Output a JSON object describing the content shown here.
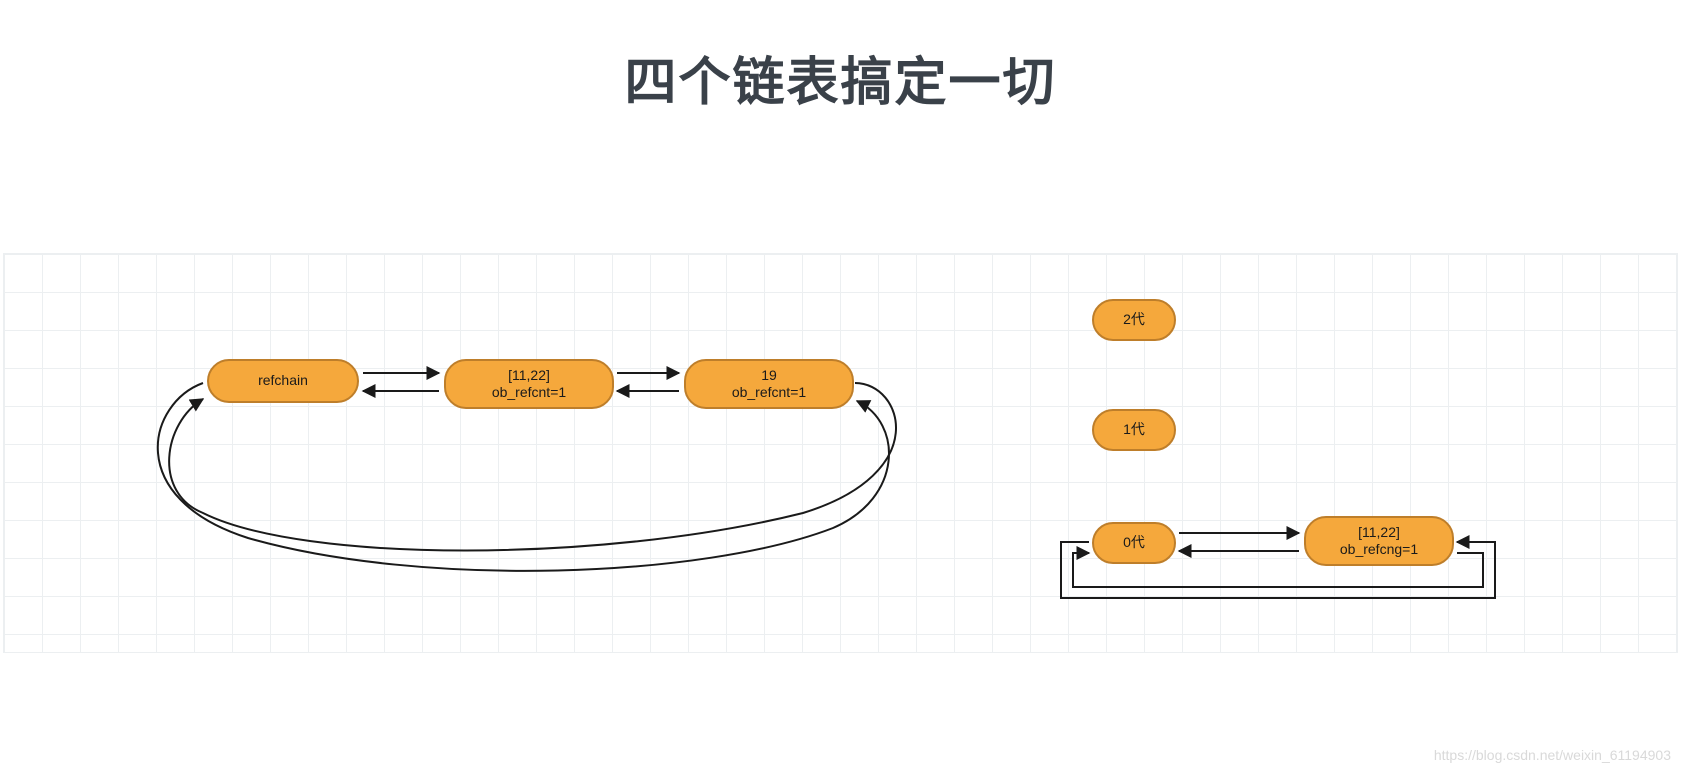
{
  "title": "四个链表搞定一切",
  "nodes": {
    "refchain": {
      "label": "refchain"
    },
    "list_11_22": {
      "line1": "[11,22]",
      "line2": "ob_refcnt=1"
    },
    "int_19": {
      "line1": "19",
      "line2": "ob_refcnt=1"
    },
    "gen2": {
      "label": "2代"
    },
    "gen1": {
      "label": "1代"
    },
    "gen0": {
      "label": "0代"
    },
    "gen0_list": {
      "line1": "[11,22]",
      "line2": "ob_refcng=1"
    }
  },
  "watermark": "https://blog.csdn.net/weixin_61194903"
}
